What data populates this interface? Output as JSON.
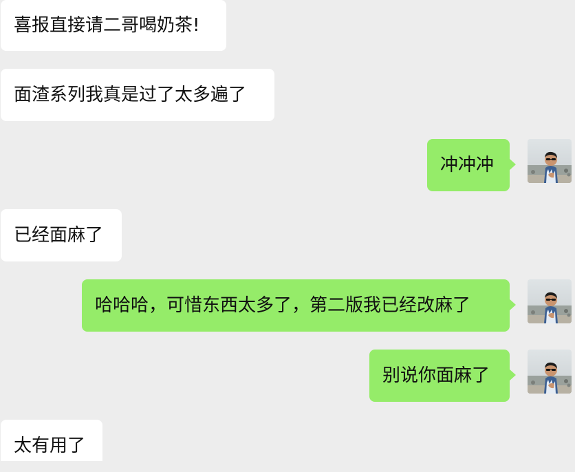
{
  "colors": {
    "background": "#ededed",
    "incoming_bubble": "#ffffff",
    "outgoing_bubble": "#95ec69",
    "text": "#111111"
  },
  "messages": [
    {
      "direction": "incoming",
      "text": "喜报直接请二哥喝奶茶!"
    },
    {
      "direction": "incoming",
      "text": "面渣系列我真是过了太多遍了"
    },
    {
      "direction": "outgoing",
      "text": "冲冲冲",
      "avatar": "user-avatar-photo"
    },
    {
      "direction": "incoming",
      "text": "已经面麻了"
    },
    {
      "direction": "outgoing",
      "text": "哈哈哈，可惜东西太多了，第二版我已经改麻了",
      "avatar": "user-avatar-photo"
    },
    {
      "direction": "outgoing",
      "text": "别说你面麻了",
      "avatar": "user-avatar-photo"
    },
    {
      "direction": "incoming",
      "text": "太有用了"
    }
  ]
}
